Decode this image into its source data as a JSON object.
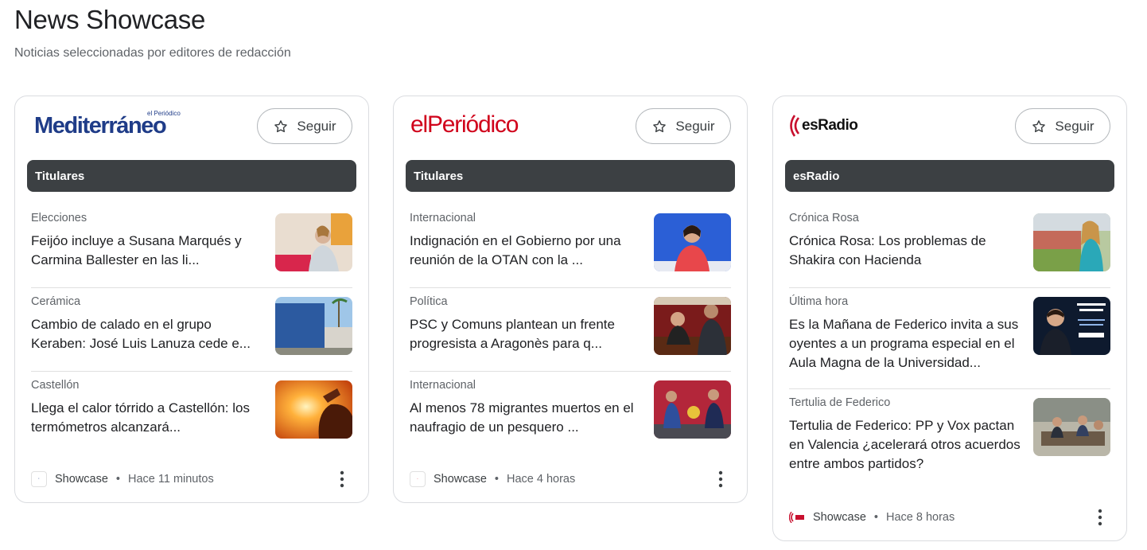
{
  "page": {
    "title": "News Showcase",
    "subtitle": "Noticias seleccionadas por editores de redacción"
  },
  "cards": [
    {
      "publisher": "Mediterráneo",
      "publisher_sub": "el Periódico",
      "follow_label": "Seguir",
      "section": "Titulares",
      "items": [
        {
          "category": "Elecciones",
          "headline": "Feijóo incluye a Susana Marqués y Carmina Ballester en las li..."
        },
        {
          "category": "Cerámica",
          "headline": "Cambio de calado en el grupo Keraben: José Luis Lanuza cede e..."
        },
        {
          "category": "Castellón",
          "headline": "Llega el calor tórrido a Castellón: los termómetros alcanzará..."
        }
      ],
      "footer": {
        "source": "Showcase",
        "time": "Hace 11 minutos"
      }
    },
    {
      "publisher": "elPeriódico",
      "follow_label": "Seguir",
      "section": "Titulares",
      "items": [
        {
          "category": "Internacional",
          "headline": "Indignación en el Gobierno por una reunión de la OTAN con la ..."
        },
        {
          "category": "Política",
          "headline": "PSC y Comuns plantean un frente progresista a Aragonès para q..."
        },
        {
          "category": "Internacional",
          "headline": "Al menos 78 migrantes muertos en el naufragio de un pesquero ..."
        }
      ],
      "footer": {
        "source": "Showcase",
        "time": "Hace 4 horas"
      }
    },
    {
      "publisher": "esRadio",
      "follow_label": "Seguir",
      "section": "esRadio",
      "items": [
        {
          "category": "Crónica Rosa",
          "headline": "Crónica Rosa: Los problemas de Shakira con Hacienda"
        },
        {
          "category": "Última hora",
          "headline": "Es la Mañana de Federico invita a sus oyentes a un programa especial en el Aula Magna de la Universidad..."
        },
        {
          "category": "Tertulia de Federico",
          "headline": "Tertulia de Federico: PP y Vox pactan en Valencia ¿acelerará otros acuerdos entre ambos partidos?"
        }
      ],
      "footer": {
        "source": "Showcase",
        "time": "Hace 8 horas"
      }
    }
  ],
  "icons": {
    "follow": "star-outline-icon",
    "more": "more-vert-icon"
  },
  "colors": {
    "section_bar": "#3c4043",
    "mediterraneo_blue": "#1f3c88",
    "elperiodico_red": "#d0021b",
    "esradio_red": "#c8102e"
  }
}
